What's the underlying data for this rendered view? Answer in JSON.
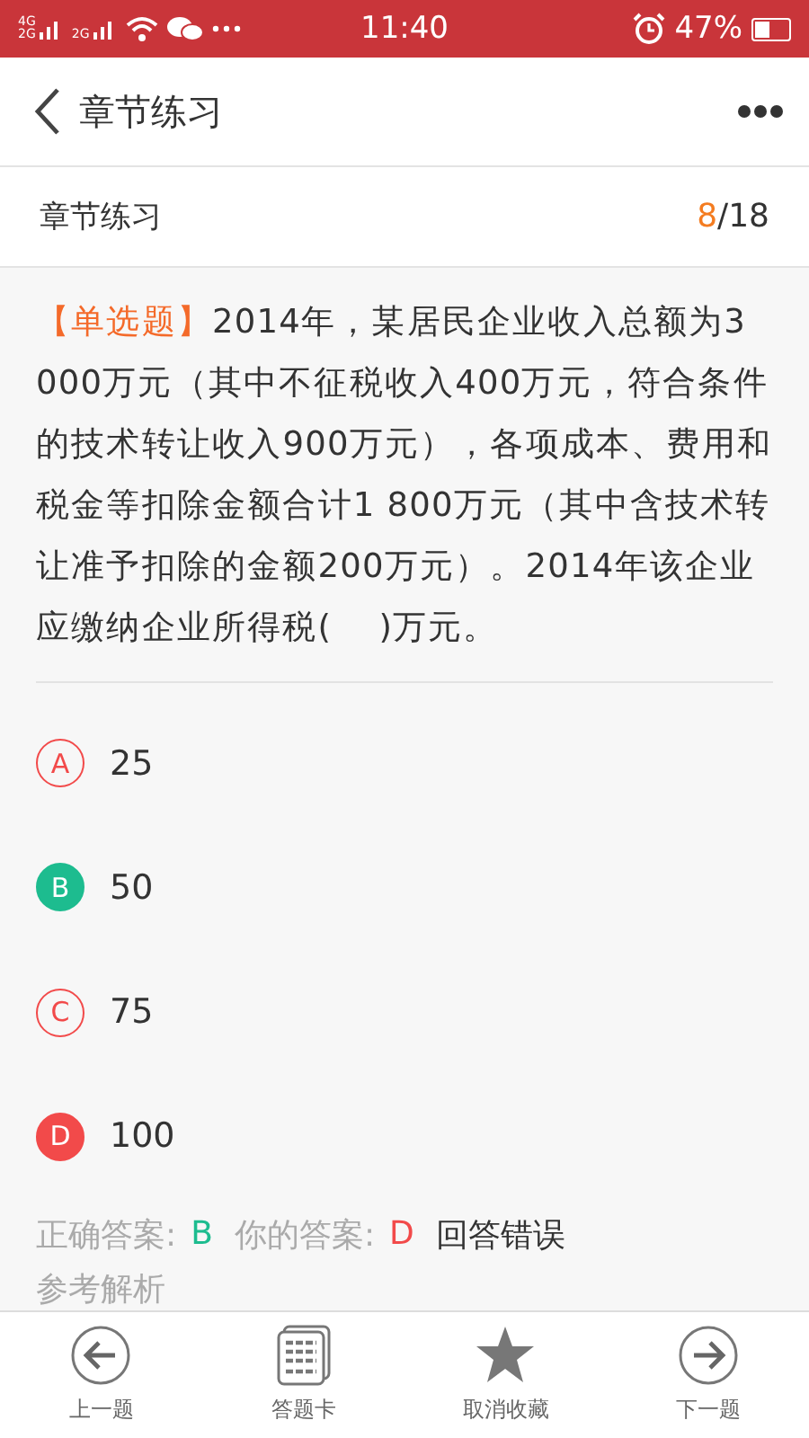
{
  "status_bar": {
    "sims": [
      {
        "labels": [
          "4G",
          "2G"
        ]
      },
      {
        "labels": [
          "2G"
        ]
      }
    ],
    "time": "11:40",
    "battery": "47%"
  },
  "header": {
    "title": "章节练习"
  },
  "subheader": {
    "title": "章节练习",
    "current": "8",
    "total": "/18"
  },
  "question": {
    "type": "【单选题】",
    "text": "2014年，某居民企业收入总额为3 000万元（其中不征税收入400万元，符合条件的技术转让收入900万元），各项成本、费用和税金等扣除金额合计1 800万元（其中含技术转让准予扣除的金额200万元）。2014年该企业应缴纳企业所得税(　 )万元。"
  },
  "options": [
    {
      "letter": "A",
      "text": "25",
      "correct": false,
      "selected": false
    },
    {
      "letter": "B",
      "text": "50",
      "correct": true,
      "selected": false
    },
    {
      "letter": "C",
      "text": "75",
      "correct": false,
      "selected": false
    },
    {
      "letter": "D",
      "text": "100",
      "correct": false,
      "selected": true
    }
  ],
  "result": {
    "correct_label": "正确答案:",
    "correct": "B",
    "yours_label": "你的答案:",
    "yours": "D",
    "verdict": "回答错误",
    "analysis_label": "参考解析"
  },
  "tabs": [
    {
      "kind": "prev",
      "label": "上一题"
    },
    {
      "kind": "card",
      "label": "答题卡"
    },
    {
      "kind": "star",
      "label": "取消收藏"
    },
    {
      "kind": "next",
      "label": "下一题"
    }
  ]
}
